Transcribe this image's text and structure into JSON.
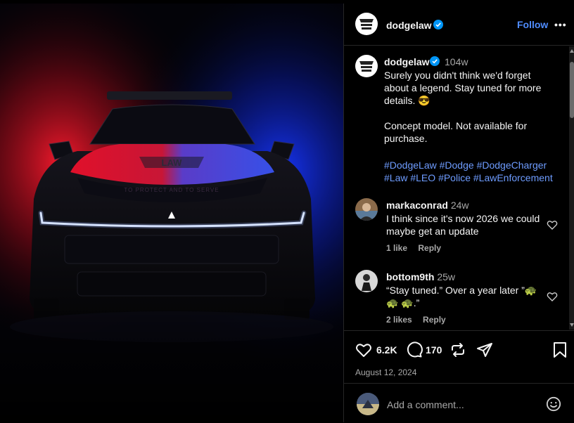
{
  "header": {
    "username": "dodgelaw",
    "follow_label": "Follow",
    "more_label": "•••"
  },
  "caption": {
    "username": "dodgelaw",
    "time": "104w",
    "text": "Surely you didn't think we'd forget about a legend. Stay tuned for more details. 😎\n\nConcept model. Not available for purchase.",
    "hashtags": [
      "#DodgeLaw",
      "#Dodge",
      "#DodgeCharger",
      "#Law",
      "#LEO",
      "#Police",
      "#LawEnforcement"
    ]
  },
  "comments": [
    {
      "username": "markaconrad",
      "time": "24w",
      "text": "I think since it's now 2026 we could maybe get an update",
      "likes": "1 like",
      "reply": "Reply"
    },
    {
      "username": "bottom9th",
      "time": "25w",
      "text": "“Stay tuned.” Over a year later ”🐢 🐢 🐢.”",
      "likes": "2 likes",
      "reply": "Reply"
    }
  ],
  "actions": {
    "likes": "6.2K",
    "comments": "170",
    "date": "August 12, 2024"
  },
  "add_comment": {
    "placeholder": "Add a comment..."
  },
  "colors": {
    "accent": "#4f8cff",
    "hashtag": "#6e9cff",
    "muted": "#a8a8a8",
    "background": "#000000",
    "light_red": "#ff1a2e",
    "light_blue": "#1736ff"
  },
  "photo": {
    "hood_logo": "LAW",
    "hood_text": "TO PROTECT AND TO SERVE"
  }
}
